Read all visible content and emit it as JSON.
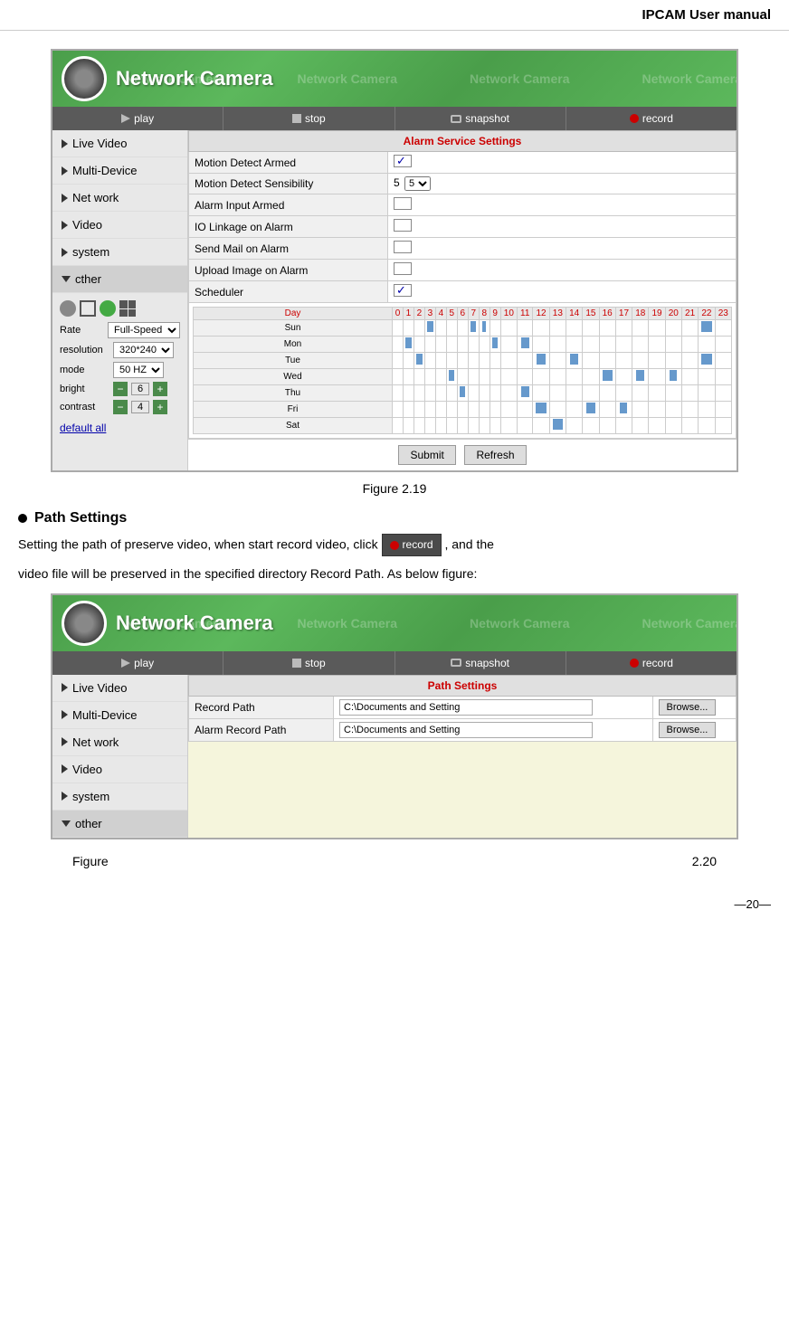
{
  "header": {
    "title": "IPCAM User manual"
  },
  "figure1": {
    "camera_header_title": "Network Camera",
    "toolbar": {
      "play_label": "play",
      "stop_label": "stop",
      "snapshot_label": "snapshot",
      "record_label": "record"
    },
    "sidebar": {
      "items": [
        {
          "label": "Live Video",
          "arrow": "right"
        },
        {
          "label": "Multi-Device",
          "arrow": "right"
        },
        {
          "label": "Net work",
          "arrow": "right"
        },
        {
          "label": "Video",
          "arrow": "right"
        },
        {
          "label": "system",
          "arrow": "right"
        },
        {
          "label": "cther",
          "arrow": "down"
        }
      ]
    },
    "controls": {
      "rate_label": "Rate",
      "rate_value": "Full-Speed",
      "resolution_label": "resolution",
      "resolution_value": "320*240",
      "mode_label": "mode",
      "mode_value": "50 HZ",
      "bright_label": "bright",
      "bright_value": "6",
      "contrast_label": "contrast",
      "contrast_value": "4",
      "default_all": "default all"
    },
    "alarm_settings": {
      "title": "Alarm Service Settings",
      "rows": [
        {
          "label": "Motion Detect Armed",
          "checked": true
        },
        {
          "label": "Motion Detect Sensibility",
          "value": "5"
        },
        {
          "label": "Alarm Input Armed",
          "checked": false
        },
        {
          "label": "IO Linkage on Alarm",
          "checked": false
        },
        {
          "label": "Send Mail on Alarm",
          "checked": false
        },
        {
          "label": "Upload Image on Alarm",
          "checked": false
        },
        {
          "label": "Scheduler",
          "checked": true
        }
      ],
      "scheduler": {
        "days": [
          "Day",
          "0",
          "1",
          "2",
          "3",
          "4",
          "5",
          "6",
          "7",
          "8",
          "9",
          "10",
          "11",
          "12",
          "13",
          "14",
          "15",
          "16",
          "17",
          "18",
          "19",
          "20",
          "21",
          "22",
          "23"
        ],
        "rows": [
          {
            "day": "Sun"
          },
          {
            "day": "Mon"
          },
          {
            "day": "Tue"
          },
          {
            "day": "Wed"
          },
          {
            "day": "Thu"
          },
          {
            "day": "Fri"
          },
          {
            "day": "Sat"
          }
        ]
      },
      "submit_label": "Submit",
      "refresh_label": "Refresh"
    },
    "caption": "Figure 2.19"
  },
  "path_section": {
    "heading": "Path Settings",
    "body_text1": "Setting the path of preserve video, when start record video, click",
    "record_btn_label": "record",
    "body_text2": ", and the",
    "body_text3": "video file will be preserved in the specified directory Record Path. As below figure:",
    "toolbar": {
      "play_label": "play",
      "stop_label": "stop",
      "snapshot_label": "snapshot",
      "record_label": "record"
    },
    "sidebar": {
      "items": [
        {
          "label": "Live Video",
          "arrow": "right"
        },
        {
          "label": "Multi-Device",
          "arrow": "right"
        },
        {
          "label": "Net work",
          "arrow": "right"
        },
        {
          "label": "Video",
          "arrow": "right"
        },
        {
          "label": "system",
          "arrow": "right"
        },
        {
          "label": "other",
          "arrow": "down"
        }
      ]
    },
    "path_settings": {
      "title": "Path Settings",
      "rows": [
        {
          "label": "Record Path",
          "value": "C:\\Documents and Setting",
          "browse": "Browse..."
        },
        {
          "label": "Alarm Record Path",
          "value": "C:\\Documents and Setting",
          "browse": "Browse..."
        }
      ]
    },
    "caption_left": "Figure",
    "caption_right": "2.20"
  },
  "footer": {
    "page_number": "—20—"
  }
}
